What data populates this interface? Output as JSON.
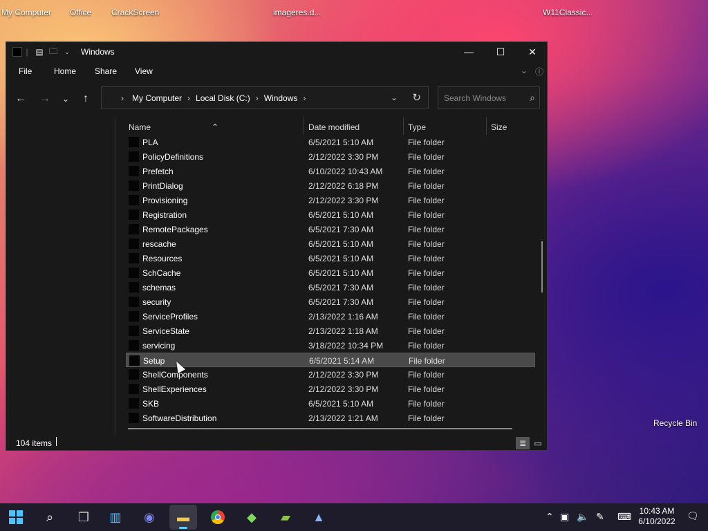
{
  "desktop": {
    "icons": [
      {
        "label": "My Computer"
      },
      {
        "label": "Office"
      },
      {
        "label": "CrackScreen"
      },
      {
        "label": "imageres.d..."
      },
      {
        "label": "W11Classic..."
      },
      {
        "label": "Recycle Bin"
      }
    ]
  },
  "window": {
    "title": "Windows",
    "menu": [
      "File",
      "Home",
      "Share",
      "View"
    ],
    "breadcrumb": [
      "My Computer",
      "Local Disk (C:)",
      "Windows"
    ],
    "search_placeholder": "Search Windows",
    "columns": {
      "name": "Name",
      "date": "Date modified",
      "type": "Type",
      "size": "Size"
    },
    "rows": [
      {
        "name": "PLA",
        "date": "6/5/2021 5:10 AM",
        "type": "File folder"
      },
      {
        "name": "PolicyDefinitions",
        "date": "2/12/2022 3:30 PM",
        "type": "File folder"
      },
      {
        "name": "Prefetch",
        "date": "6/10/2022 10:43 AM",
        "type": "File folder"
      },
      {
        "name": "PrintDialog",
        "date": "2/12/2022 6:18 PM",
        "type": "File folder"
      },
      {
        "name": "Provisioning",
        "date": "2/12/2022 3:30 PM",
        "type": "File folder"
      },
      {
        "name": "Registration",
        "date": "6/5/2021 5:10 AM",
        "type": "File folder"
      },
      {
        "name": "RemotePackages",
        "date": "6/5/2021 7:30 AM",
        "type": "File folder"
      },
      {
        "name": "rescache",
        "date": "6/5/2021 5:10 AM",
        "type": "File folder"
      },
      {
        "name": "Resources",
        "date": "6/5/2021 5:10 AM",
        "type": "File folder"
      },
      {
        "name": "SchCache",
        "date": "6/5/2021 5:10 AM",
        "type": "File folder"
      },
      {
        "name": "schemas",
        "date": "6/5/2021 7:30 AM",
        "type": "File folder"
      },
      {
        "name": "security",
        "date": "6/5/2021 7:30 AM",
        "type": "File folder"
      },
      {
        "name": "ServiceProfiles",
        "date": "2/13/2022 1:16 AM",
        "type": "File folder"
      },
      {
        "name": "ServiceState",
        "date": "2/13/2022 1:18 AM",
        "type": "File folder"
      },
      {
        "name": "servicing",
        "date": "3/18/2022 10:34 PM",
        "type": "File folder"
      },
      {
        "name": "Setup",
        "date": "6/5/2021 5:14 AM",
        "type": "File folder",
        "selected": true
      },
      {
        "name": "ShellComponents",
        "date": "2/12/2022 3:30 PM",
        "type": "File folder"
      },
      {
        "name": "ShellExperiences",
        "date": "2/12/2022 3:30 PM",
        "type": "File folder"
      },
      {
        "name": "SKB",
        "date": "6/5/2021 5:10 AM",
        "type": "File folder"
      },
      {
        "name": "SoftwareDistribution",
        "date": "2/13/2022 1:21 AM",
        "type": "File folder"
      }
    ],
    "status": {
      "item_count": "104 items"
    }
  },
  "taskbar": {
    "apps": [
      {
        "icon": "windows-start-icon"
      },
      {
        "icon": "search-icon"
      },
      {
        "icon": "task-view-icon"
      },
      {
        "icon": "widgets-icon"
      },
      {
        "icon": "chat-icon"
      },
      {
        "icon": "file-explorer-icon",
        "active": true
      },
      {
        "icon": "chrome-icon"
      },
      {
        "icon": "bluestacks-icon"
      },
      {
        "icon": "notepad-plus-icon"
      },
      {
        "icon": "app-icon"
      }
    ],
    "clock": {
      "time": "10:43 AM",
      "date": "6/10/2022"
    },
    "accent": "#60cdff"
  }
}
